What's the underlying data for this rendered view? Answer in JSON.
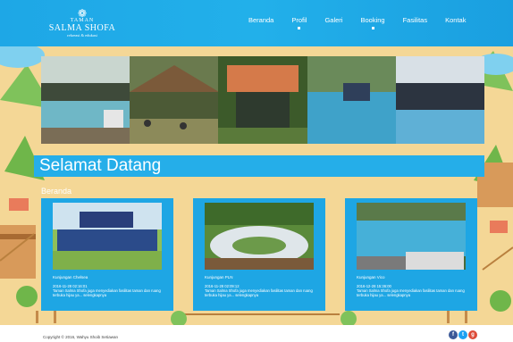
{
  "brand": {
    "mark": "❁",
    "line1": "TAMAN",
    "line2": "SALMA SHOFA",
    "tagline": "rekreasi & edukasi"
  },
  "nav": [
    {
      "label": "Beranda",
      "active": false
    },
    {
      "label": "Profil",
      "active": true
    },
    {
      "label": "Galeri",
      "active": false
    },
    {
      "label": "Booking",
      "active": true
    },
    {
      "label": "Fasilitas",
      "active": false
    },
    {
      "label": "Kontak",
      "active": false
    }
  ],
  "welcome": "Selamat Datang",
  "section_label": "Beranda",
  "cards": [
    {
      "title": "Kunjungan Chelsea",
      "date": "2016-11-28 02:16:01",
      "excerpt": "Taman Salma Shofa juga menyediakan fasilitas taman dan ruang terbuka hijau ya... selengkapnya"
    },
    {
      "title": "Kunjungan PLN",
      "date": "2016-11-28 02:09:12",
      "excerpt": "Taman Salma Shofa juga menyediakan fasilitas taman dan ruang terbuka hijau ya... selengkapnya"
    },
    {
      "title": "Kunjungan Vico",
      "date": "2016-12-28 15:36:00",
      "excerpt": "Taman Salma Shofa juga menyediakan fasilitas taman dan ruang terbuka hijau ya... selengkapnya"
    }
  ],
  "footer": {
    "copyright": "Copyright © 2016, Wahyu Shoib Setiawan"
  },
  "social": [
    {
      "icon": "facebook-icon",
      "glyph": "f",
      "color": "#3b5998"
    },
    {
      "icon": "twitter-icon",
      "glyph": "t",
      "color": "#1da1f2"
    },
    {
      "icon": "google-plus-icon",
      "glyph": "g",
      "color": "#dd4b39"
    }
  ],
  "colors": {
    "accent": "#25aee9",
    "header": "#1ea7e6"
  }
}
